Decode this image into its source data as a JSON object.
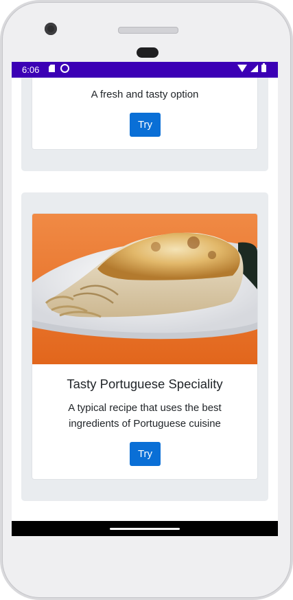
{
  "status_bar": {
    "time": "6:06",
    "icons": [
      "sd-card-icon",
      "sync-icon",
      "wifi-icon",
      "cell-signal-icon",
      "battery-icon"
    ],
    "color": "#3c00b5"
  },
  "cards": [
    {
      "title": "",
      "description": "A fresh and tasty option",
      "button_label": "Try"
    },
    {
      "title": "Tasty Portuguese Speciality",
      "description_line1": "A typical recipe that uses the best",
      "description_line2": "ingredients of Portuguese cuisine",
      "button_label": "Try",
      "image": "baked-pasta-dish-photo"
    }
  ],
  "colors": {
    "button": "#0a6fd6",
    "panel": "#e9ecef",
    "image_background": "#f07a30"
  }
}
